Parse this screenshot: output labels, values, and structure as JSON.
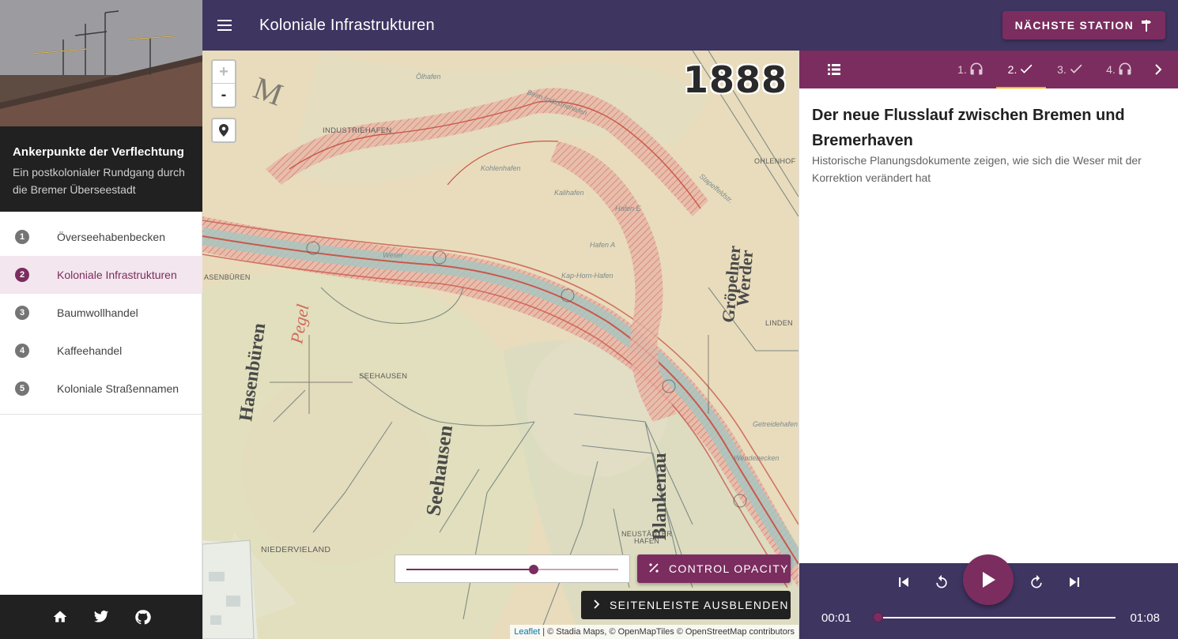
{
  "app": {
    "title": "Ankerpunkte der Verflechtung",
    "subtitle": "Ein postkolonialer Rundgang durch die Bremer Überseestadt"
  },
  "sidebar": {
    "stations": [
      {
        "number": "1",
        "label": "Överseehabenbecken",
        "active": false
      },
      {
        "number": "2",
        "label": "Koloniale Infrastrukturen",
        "active": true
      },
      {
        "number": "3",
        "label": "Baumwollhandel",
        "active": false
      },
      {
        "number": "4",
        "label": "Kaffeehandel",
        "active": false
      },
      {
        "number": "5",
        "label": "Koloniale Straßennamen",
        "active": false
      }
    ],
    "footer_icons": [
      "home-icon",
      "twitter-icon",
      "github-icon"
    ]
  },
  "header": {
    "title": "Koloniale Infrastrukturen",
    "next_label": "NÄCHSTE STATION"
  },
  "map": {
    "year": "1888",
    "zoom_in": "+",
    "zoom_out": "-",
    "opacity_value": 0.6,
    "opacity_label": "CONTROL OPACITY",
    "hide_sidebar_label": "SEITENLEISTE AUSBLENDEN",
    "attribution": {
      "leaflet": "Leaflet",
      "sep": "|",
      "text": "© Stadia Maps, ©",
      "omt": "OpenMapTiles",
      "copy": "©",
      "osm": "OpenStreetMap",
      "contrib": "contributors"
    },
    "place_labels": {
      "industriehafen": "INDUSTRIEHAFEN",
      "seehausen": "SEEHAUSEN",
      "niedervieland": "NIEDERVIELAND",
      "neustaedter": "NEUSTÄDTER",
      "hafen": "HAFEN",
      "ohlenhof": "OHLENHOF",
      "hasenbueren": "ASENBÜREN",
      "lindenhof": "LINDEN",
      "olhafen": "Ölhafen",
      "kalihafen": "Kalihafen",
      "kohlenhafen": "Kohlenhafen",
      "hafen_e": "Hafen E",
      "hafen_a": "Hafen A",
      "kap_horn": "Kap-Horn-Hafen",
      "getreide": "Getreidehafen",
      "wendebecken": "Wendebecken",
      "stapelfeld": "Stapelfeldstr.",
      "weser": "Weser",
      "beim_industriehafen": "Beim Industriehafen",
      "hist_hasenbueren": "Hasenbüren",
      "hist_seehausen": "Seehausen",
      "hist_pegel": "Pegel",
      "hist_groepelner": "Gröpelner",
      "hist_werder": "Werder",
      "hist_blankenau": "Blankenau"
    }
  },
  "panel": {
    "tabs": [
      {
        "label": "1.",
        "icon": "headphones-icon",
        "active": false
      },
      {
        "label": "2.",
        "icon": "check-icon",
        "active": true
      },
      {
        "label": "3.",
        "icon": "check-icon",
        "active": false
      },
      {
        "label": "4.",
        "icon": "headphones-icon",
        "active": false
      }
    ],
    "content_title": "Der neue Flusslauf zwischen Bremen und Bremerhaven",
    "content_subtitle": "Historische Planungsdokumente zeigen, wie sich die Weser mit der Korrektion verändert hat"
  },
  "player": {
    "current_time": "00:01",
    "total_time": "01:08",
    "progress": 0.015
  },
  "colors": {
    "topbar": "#3e3561",
    "accent": "#7b2d5f",
    "tab_indicator": "#f2b705",
    "dark": "#212121"
  }
}
